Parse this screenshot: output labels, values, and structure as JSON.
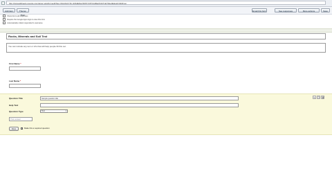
{
  "browser": {
    "url": "http://spreadsheets.google.com/a/usc.edu/formedit?key=0AvhkC7Jb-nNhdE0wVFRfYzVPVUdMaXhzbTdqT0tuclE&gid=0&hl=en"
  },
  "toolbar": {
    "add_item_label": "Add item",
    "theme_label": "Theme: Plain",
    "email_label": "Email this form",
    "see_responses_label": "See responses",
    "more_actions_label": "More actions",
    "save_label": "Save"
  },
  "notices": [
    "Show link to all responses",
    "Require the Google Apps login to view this form",
    "Automatically collect respondent's username"
  ],
  "form": {
    "title": "Rocks, Minerals and Soil Test",
    "description": "You can include any text or info that will help people fill this out.",
    "first_name_label": "First Name",
    "last_name_label": "Last Name",
    "required_star": "*"
  },
  "editor": {
    "question_title_label": "Question Title",
    "question_title_value": "Sample question title",
    "help_text_label": "Help Text",
    "help_text_value": "",
    "question_type_label": "Question Type",
    "question_type_value": "Text",
    "preview_value": "Their answer",
    "done_label": "Done",
    "required_label": "Make this a required question",
    "edit_icon": "pencil-icon",
    "duplicate_icon": "copy-icon",
    "delete_icon": "trash-icon"
  }
}
